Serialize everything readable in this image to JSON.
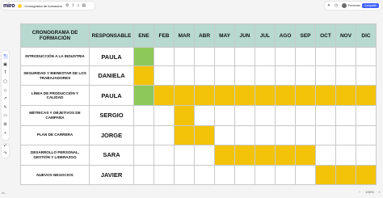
{
  "app": {
    "logo": "miro",
    "board_name": "Cronograma de formacion",
    "presenter_label": "Presentar",
    "share_label": "Compartir",
    "zoom": "100%"
  },
  "colors": {
    "header_bg": "#b7d9cf",
    "green": "#8dc95a",
    "yellow": "#f3c309"
  },
  "table": {
    "title": "CRONOGRAMA DE FORMACIÓN",
    "responsable_header": "RESPONSABLE",
    "months": [
      "ENE",
      "FEB",
      "MAR",
      "ABR",
      "MAY",
      "JUN",
      "JUL",
      "AGO",
      "SEP",
      "OCT",
      "NOV",
      "DIC"
    ],
    "rows": [
      {
        "activity": "INTRODUCCIÓN A LA INDUSTRIA",
        "person": "PAULA",
        "cells": [
          "green",
          "",
          "",
          "",
          "",
          "",
          "",
          "",
          "",
          "",
          "",
          ""
        ]
      },
      {
        "activity": "SEGURIDAD Y BIENESTAR DE LOS TRABAJADORES",
        "person": "DANIELA",
        "cells": [
          "yellow",
          "",
          "",
          "",
          "",
          "",
          "",
          "",
          "",
          "",
          "",
          ""
        ]
      },
      {
        "activity": "LÍNEA DE PRODUCCIÓN Y CALIDAD",
        "person": "PAULA",
        "cells": [
          "green",
          "yellow",
          "yellow",
          "yellow",
          "yellow",
          "yellow",
          "yellow",
          "yellow",
          "yellow",
          "yellow",
          "yellow",
          "yellow"
        ]
      },
      {
        "activity": "MÉTRICAS Y OBJETIVOS DE CAMPAÑA",
        "person": "SERGIO",
        "cells": [
          "",
          "",
          "yellow",
          "",
          "",
          "",
          "",
          "",
          "",
          "",
          "",
          ""
        ]
      },
      {
        "activity": "PLAN DE CARRERA",
        "person": "JORGE",
        "cells": [
          "",
          "",
          "yellow",
          "yellow",
          "",
          "",
          "",
          "",
          "",
          "",
          "",
          ""
        ]
      },
      {
        "activity": "DESARROLLO PERSONAL, GESTIÓN Y LIDERAZGO",
        "person": "SARA",
        "cells": [
          "",
          "",
          "",
          "",
          "yellow",
          "yellow",
          "yellow",
          "yellow",
          "yellow",
          "",
          "",
          ""
        ]
      },
      {
        "activity": "NUEVOS NEGOCIOS",
        "person": "JAVIER",
        "cells": [
          "",
          "",
          "",
          "",
          "",
          "",
          "",
          "",
          "",
          "yellow",
          "yellow",
          "yellow"
        ]
      }
    ]
  }
}
